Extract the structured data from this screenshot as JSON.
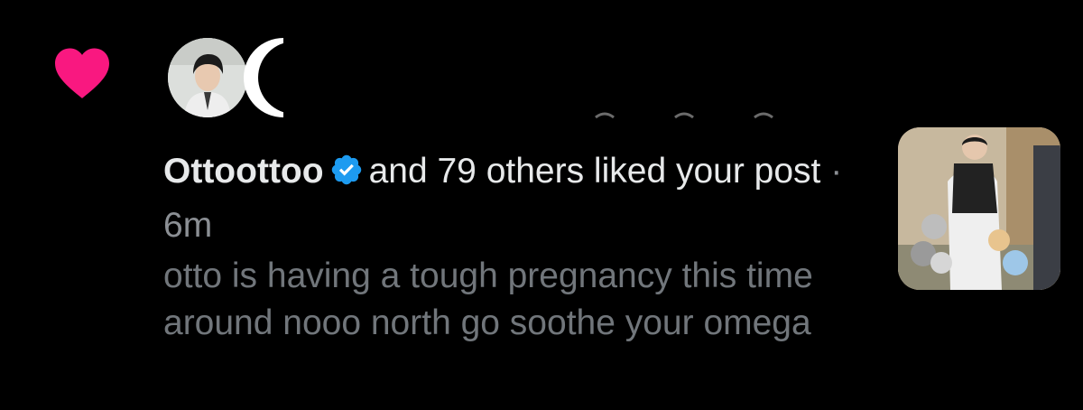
{
  "notification": {
    "type_icon": "heart-icon",
    "avatars": [
      {
        "icon": "user-avatar"
      },
      {
        "icon": "user-avatar"
      }
    ],
    "username": "Ottoottoo",
    "verified_icon": "verified-badge-icon",
    "action_text": "and 79 others liked your post",
    "separator": "·",
    "timestamp": "6m",
    "post_preview": "otto is having a tough pregnancy this time around nooo north go soothe your omega",
    "thumbnail_icon": "post-media-thumbnail"
  },
  "colors": {
    "background": "#000000",
    "heart": "#f91880",
    "verified": "#1d9bf0",
    "primary_text": "#e7e9ea",
    "secondary_text": "#71767b"
  }
}
